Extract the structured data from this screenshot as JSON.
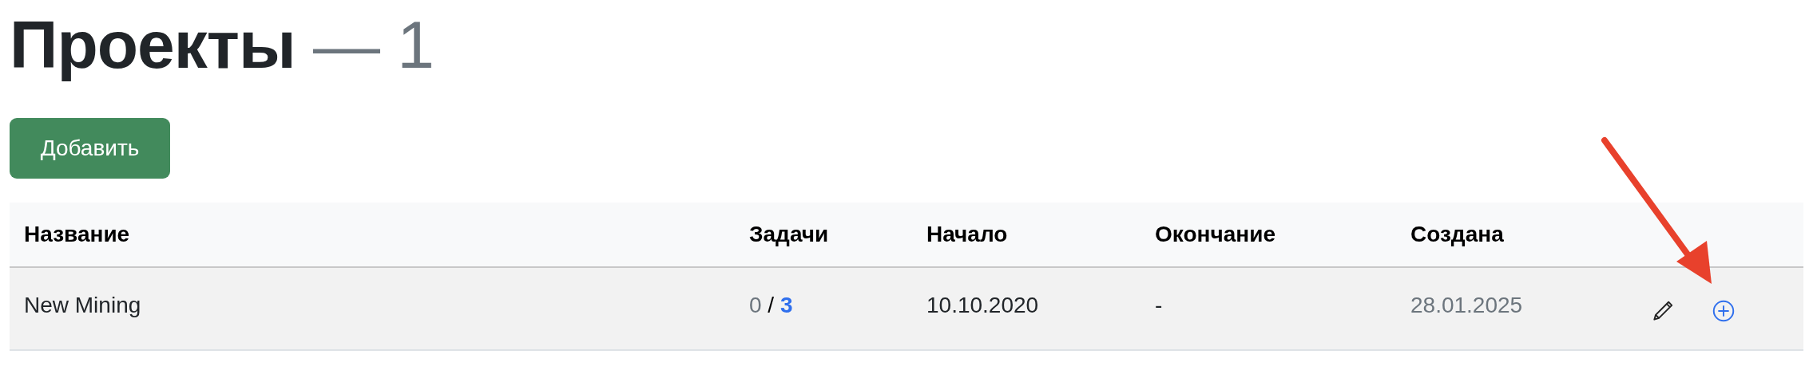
{
  "page": {
    "title": "Проекты",
    "separator": "—",
    "count": "1"
  },
  "add_button": {
    "label": "Добавить"
  },
  "table": {
    "columns": [
      "Название",
      "Задачи",
      "Начало",
      "Окончание",
      "Создана"
    ],
    "rows": [
      {
        "name": "New Mining",
        "tasks_done": "0",
        "tasks_sep": "/",
        "tasks_total": "3",
        "start": "10.10.2020",
        "end": "-",
        "created": "28.01.2025"
      }
    ]
  }
}
